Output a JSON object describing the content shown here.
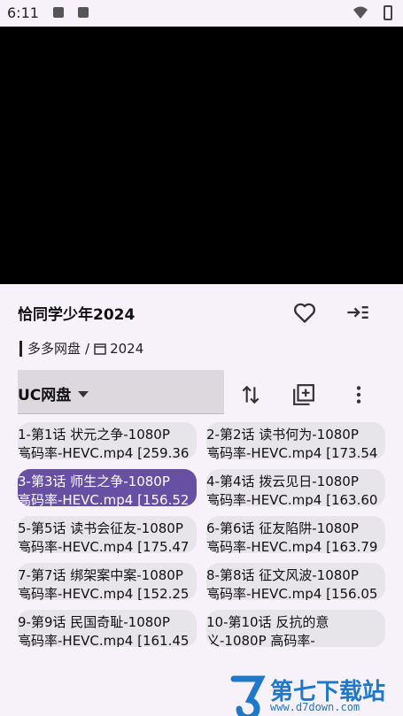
{
  "status": {
    "time": "6:11"
  },
  "player": {
    "title": "恰同学少年2024",
    "source_line_prefix": "",
    "source": "多多网盘",
    "separator": "/",
    "year": "2024"
  },
  "line": {
    "selected": "UC网盘"
  },
  "episodes": [
    {
      "l1": "1-第1话 状元之争-1080P",
      "l2": "高码率-HEVC.mp4 [259.36",
      "selected": false
    },
    {
      "l1": "2-第2话 读书何为-1080P",
      "l2": "高码率-HEVC.mp4 [173.54",
      "selected": false
    },
    {
      "l1": "3-第3话 师生之争-1080P",
      "l2": "高码率-HEVC.mp4 [156.52",
      "selected": true
    },
    {
      "l1": "4-第4话 拨云见日-1080P",
      "l2": "高码率-HEVC.mp4 [163.60",
      "selected": false
    },
    {
      "l1": "5-第5话 读书会征友-1080P",
      "l2": "高码率-HEVC.mp4 [175.47",
      "selected": false
    },
    {
      "l1": "6-第6话 征友陷阱-1080P",
      "l2": "高码率-HEVC.mp4 [163.79",
      "selected": false
    },
    {
      "l1": "7-第7话 绑架案中案-1080P",
      "l2": "高码率-HEVC.mp4 [152.25",
      "selected": false
    },
    {
      "l1": "8-第8话 征文风波-1080P",
      "l2": "高码率-HEVC.mp4 [156.05",
      "selected": false
    },
    {
      "l1": "9-第9话 民国奇耻-1080P",
      "l2": "高码率-HEVC.mp4 [161.45",
      "selected": false
    },
    {
      "l1": "10-第10话 反抗的意",
      "l2": "义-1080P 高码率-",
      "selected": false
    }
  ],
  "watermark": {
    "brand": "第七下载站",
    "url": "www.d7down.com"
  },
  "colors": {
    "accent": "#6750a4",
    "background": "#f7f2fa",
    "chip": "#e7e4ea"
  },
  "icons": {
    "favorite": "heart-icon",
    "exit": "exit-icon",
    "sort": "sort-icon",
    "add": "add-to-library-icon",
    "more": "more-vert-icon"
  }
}
